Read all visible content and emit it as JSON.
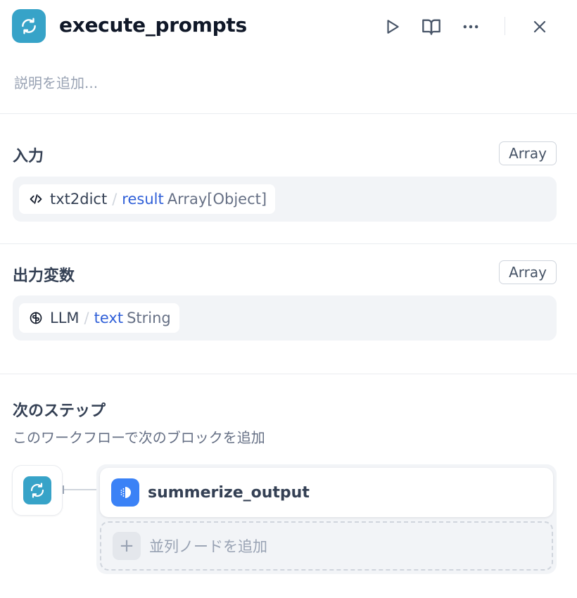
{
  "header": {
    "title": "execute_prompts",
    "description_placeholder": "説明を追加..."
  },
  "input_section": {
    "title": "入力",
    "type_badge": "Array",
    "variable": {
      "node": "txt2dict",
      "name": "result",
      "type": "Array[Object]",
      "icon": "code-icon"
    }
  },
  "output_section": {
    "title": "出力変数",
    "type_badge": "Array",
    "variable": {
      "node": "LLM",
      "name": "text",
      "type": "String",
      "icon": "llm-icon"
    }
  },
  "next_step": {
    "title": "次のステップ",
    "subtitle": "このワークフローで次のブロックを追加",
    "next_node": "summerize_output",
    "add_parallel_label": "並列ノードを追加"
  },
  "colors": {
    "iteration_icon_bg": "#37a3c8",
    "llm_icon_bg": "#3b82f6",
    "variable_name": "#2f5fd8"
  }
}
